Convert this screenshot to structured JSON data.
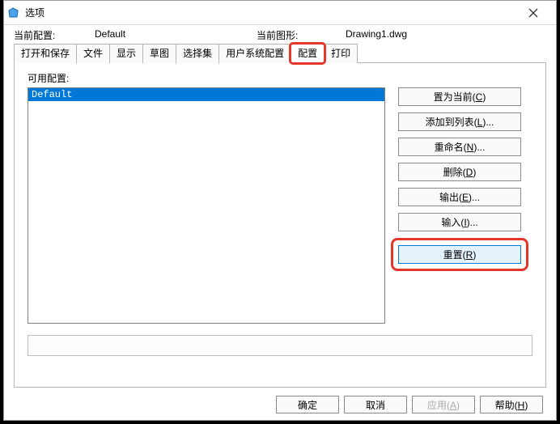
{
  "window": {
    "title": "选项",
    "close_label": "×"
  },
  "info": {
    "current_profile_label": "当前配置:",
    "current_profile_value": "Default",
    "current_drawing_label": "当前图形:",
    "current_drawing_value": "Drawing1.dwg"
  },
  "tabs": {
    "items": [
      {
        "label": "打开和保存"
      },
      {
        "label": "文件"
      },
      {
        "label": "显示"
      },
      {
        "label": "草图"
      },
      {
        "label": "选择集"
      },
      {
        "label": "用户系统配置"
      },
      {
        "label": "配置"
      },
      {
        "label": "打印"
      }
    ],
    "active_index": 6
  },
  "panel": {
    "available_label": "可用配置:",
    "list": [
      "Default"
    ],
    "buttons": {
      "set_current": "置为当前(C)",
      "add_to_list": "添加到列表(L)...",
      "rename": "重命名(N)...",
      "delete": "删除(D)",
      "export": "输出(E)...",
      "import": "输入(I)...",
      "reset": "重置(R)"
    }
  },
  "footer": {
    "ok": "确定",
    "cancel": "取消",
    "apply": "应用(A)",
    "help": "帮助(H)"
  }
}
